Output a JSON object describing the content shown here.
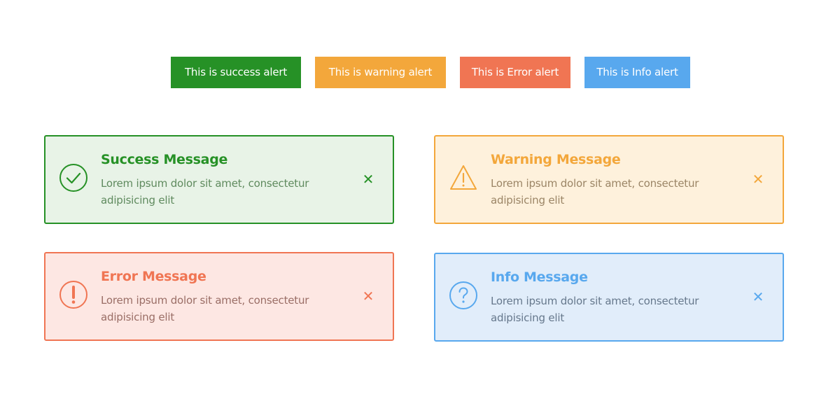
{
  "triggers": {
    "success": {
      "label": "This is success alert",
      "color": "#269126"
    },
    "warning": {
      "label": "This is warning alert",
      "color": "#f3a73b"
    },
    "error": {
      "label": "This is Error alert",
      "color": "#f07553"
    },
    "info": {
      "label": "This is Info alert",
      "color": "#58a8ee"
    }
  },
  "alerts": {
    "success": {
      "icon": "check-circle-icon",
      "title": "Success Message",
      "text": "Lorem ipsum dolor sit amet, consectetur adipisicing elit",
      "close": "✕",
      "accent": "#269126",
      "background": "#e8f3e7",
      "text_color": "#5f8a5e"
    },
    "warning": {
      "icon": "warning-triangle-icon",
      "title": "Warning Message",
      "text": "Lorem ipsum dolor sit amet, consectetur adipisicing elit",
      "close": "✕",
      "accent": "#f3a73b",
      "background": "#fef1dc",
      "text_color": "#9b8566"
    },
    "error": {
      "icon": "exclamation-circle-icon",
      "title": "Error Message",
      "text": "Lorem ipsum dolor sit amet, consectetur adipisicing elit",
      "close": "✕",
      "accent": "#f07553",
      "background": "#fde7e3",
      "text_color": "#9a6e66"
    },
    "info": {
      "icon": "question-circle-icon",
      "title": "Info Message",
      "text": "Lorem ipsum dolor sit amet, consectetur adipisicing elit",
      "close": "✕",
      "accent": "#58a8ee",
      "background": "#e1edfa",
      "text_color": "#66788c"
    }
  }
}
